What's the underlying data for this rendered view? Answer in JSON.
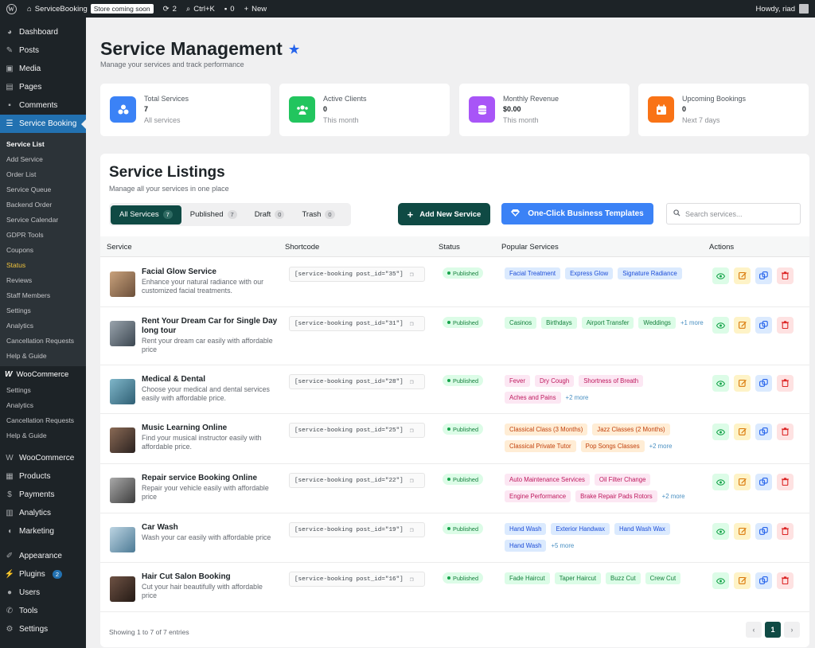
{
  "adminbar": {
    "site_name": "ServiceBooking",
    "store_badge": "Store coming soon",
    "updates": "2",
    "search_shortcut": "Ctrl+K",
    "comments": "0",
    "new_label": "New",
    "howdy": "Howdy, riad"
  },
  "sidebar": {
    "top": [
      {
        "icon": "dashboard-icon",
        "label": "Dashboard"
      },
      {
        "icon": "pin-icon",
        "label": "Posts"
      },
      {
        "icon": "media-icon",
        "label": "Media"
      },
      {
        "icon": "pages-icon",
        "label": "Pages"
      },
      {
        "icon": "comment-icon",
        "label": "Comments"
      }
    ],
    "active": {
      "icon": "list-icon",
      "label": "Service Booking"
    },
    "submenu": [
      "Service List",
      "Add Service",
      "Order List",
      "Service Queue",
      "Backend Order",
      "Service Calendar",
      "GDPR Tools",
      "Coupons",
      "Status",
      "Reviews",
      "Staff Members",
      "Settings",
      "Analytics",
      "Cancellation Requests",
      "Help & Guide"
    ],
    "woo_group": {
      "logo": "W",
      "label": "WooCommerce",
      "items": [
        "Settings",
        "Analytics",
        "Cancellation Requests",
        "Help & Guide"
      ]
    },
    "bottom": [
      {
        "icon": "woo-icon",
        "label": "WooCommerce"
      },
      {
        "icon": "products-icon",
        "label": "Products"
      },
      {
        "icon": "payments-icon",
        "label": "Payments"
      },
      {
        "icon": "analytics-icon",
        "label": "Analytics"
      },
      {
        "icon": "megaphone-icon",
        "label": "Marketing"
      }
    ],
    "bottom2": [
      {
        "icon": "brush-icon",
        "label": "Appearance"
      },
      {
        "icon": "plugin-icon",
        "label": "Plugins",
        "badge": "2"
      },
      {
        "icon": "users-icon",
        "label": "Users"
      },
      {
        "icon": "wrench-icon",
        "label": "Tools"
      },
      {
        "icon": "settings-icon",
        "label": "Settings"
      }
    ]
  },
  "header": {
    "title": "Service Management",
    "subtitle": "Manage your services and track performance"
  },
  "stats": [
    {
      "label": "Total Services",
      "value": "7",
      "note": "All services",
      "color": "#3b82f6",
      "icon": "cubes-icon"
    },
    {
      "label": "Active Clients",
      "value": "0",
      "note": "This month",
      "color": "#22c55e",
      "icon": "users-icon"
    },
    {
      "label": "Monthly Revenue",
      "value": "$0.00",
      "note": "This month",
      "color": "#a855f7",
      "icon": "coins-icon"
    },
    {
      "label": "Upcoming Bookings",
      "value": "0",
      "note": "Next 7 days",
      "color": "#f97316",
      "icon": "calendar-icon"
    }
  ],
  "listing": {
    "title": "Service Listings",
    "subtitle": "Manage all your services in one place",
    "tabs": [
      {
        "label": "All Services",
        "count": "7"
      },
      {
        "label": "Published",
        "count": "7"
      },
      {
        "label": "Draft",
        "count": "0"
      },
      {
        "label": "Trash",
        "count": "0"
      }
    ],
    "add_button": "Add New Service",
    "templates_button": "One-Click Business Templates",
    "search_placeholder": "Search services...",
    "columns": [
      "Service",
      "Shortcode",
      "Status",
      "Popular Services",
      "Actions"
    ],
    "footer": "Showing 1 to 7 of 7 entries",
    "page": "1"
  },
  "rows": [
    {
      "name": "Facial Glow Service",
      "desc": "Enhance your natural radiance with our customized facial treatments.",
      "shortcode": "[service-booking post_id=\"35\"]",
      "status": "Published",
      "tag_style": "blue",
      "tags": [
        "Facial Treatment",
        "Express Glow",
        "Signature Radiance"
      ],
      "more": ""
    },
    {
      "name": "Rent Your Dream Car for Single Day long tour",
      "desc": "Rent your dream car easily with affordable price",
      "shortcode": "[service-booking post_id=\"31\"]",
      "status": "Published",
      "tag_style": "green",
      "tags": [
        "Casinos",
        "Birthdays",
        "Airport Transfer",
        "Weddings"
      ],
      "more": "+1 more"
    },
    {
      "name": "Medical & Dental",
      "desc": "Choose your medical and dental services easily with affordable price.",
      "shortcode": "[service-booking post_id=\"28\"]",
      "status": "Published",
      "tag_style": "pink",
      "tags": [
        "Fever",
        "Dry Cough",
        "Shortness of Breath",
        "Aches and Pains"
      ],
      "more": "+2 more"
    },
    {
      "name": "Music Learning Online",
      "desc": "Find your musical instructor easily with affordable price.",
      "shortcode": "[service-booking post_id=\"25\"]",
      "status": "Published",
      "tag_style": "orange",
      "tags": [
        "Classical Class (3 Months)",
        "Jazz Classes (2 Months)",
        "Classical Private Tutor",
        "Pop Songs Classes"
      ],
      "more": "+2 more"
    },
    {
      "name": "Repair service Booking Online",
      "desc": "Repair your vehicle easily with affordable price",
      "shortcode": "[service-booking post_id=\"22\"]",
      "status": "Published",
      "tag_style": "pink",
      "tags": [
        "Auto Maintenance Services",
        "Oil Filter Change",
        "Engine Performance",
        "Brake Repair Pads Rotors"
      ],
      "more": "+2 more"
    },
    {
      "name": "Car Wash",
      "desc": "Wash your car easily with affordable price",
      "shortcode": "[service-booking post_id=\"19\"]",
      "status": "Published",
      "tag_style": "blue",
      "tags": [
        "Hand Wash",
        "Exterior Handwax",
        "Hand Wash Wax",
        "Hand Wash"
      ],
      "more": "+5 more"
    },
    {
      "name": "Hair Cut Salon Booking",
      "desc": "Cut your hair beautifully with affordable price",
      "shortcode": "[service-booking post_id=\"16\"]",
      "status": "Published",
      "tag_style": "green",
      "tags": [
        "Fade Haircut",
        "Taper Haircut",
        "Buzz Cut",
        "Crew Cut"
      ],
      "more": ""
    }
  ],
  "tag_colors": {
    "blue": {
      "bg": "#dbeafe",
      "fg": "#1d4ed8"
    },
    "green": {
      "bg": "#dcfce7",
      "fg": "#15803d"
    },
    "pink": {
      "bg": "#fce7f3",
      "fg": "#be185d"
    },
    "orange": {
      "bg": "#ffedd5",
      "fg": "#c2410c"
    }
  }
}
